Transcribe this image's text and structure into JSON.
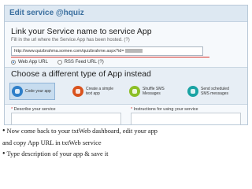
{
  "header": {
    "title": "Edit service @hquiz"
  },
  "link_section": {
    "heading": "Link your Service name to service App",
    "subtext": "Fill in the url where the Service App has been hosted. (?)",
    "url_value": "http://www.quizbrahma.somee.com/quizbrahme.aspx?id=",
    "radios": [
      {
        "label": "Web App URL",
        "checked": true
      },
      {
        "label": "RSS Feed URL (?)",
        "checked": false
      }
    ]
  },
  "app_section": {
    "heading": "Choose a different type of App instead",
    "options": [
      {
        "label": "Code your app",
        "icon": "code-app-icon",
        "color": "#2f7fc9"
      },
      {
        "label": "Create a simple text app",
        "icon": "text-app-icon",
        "color": "#d9531e"
      },
      {
        "label": "Shuffle SMS Messages",
        "icon": "shuffle-sms-icon",
        "color": "#8cbf26"
      },
      {
        "label": "Send scheduled SMS messages",
        "icon": "schedule-sms-icon",
        "color": "#1aa3a3"
      }
    ]
  },
  "form": {
    "describe_label": "Describe your service",
    "instructions_label": "Instructions for using your service",
    "required_mark": "*"
  },
  "bullets": [
    "Now come back to your txtWeb dashboard, edit your app",
    "and copy App URL in txtWeb service",
    "Type description of your app & save it"
  ]
}
